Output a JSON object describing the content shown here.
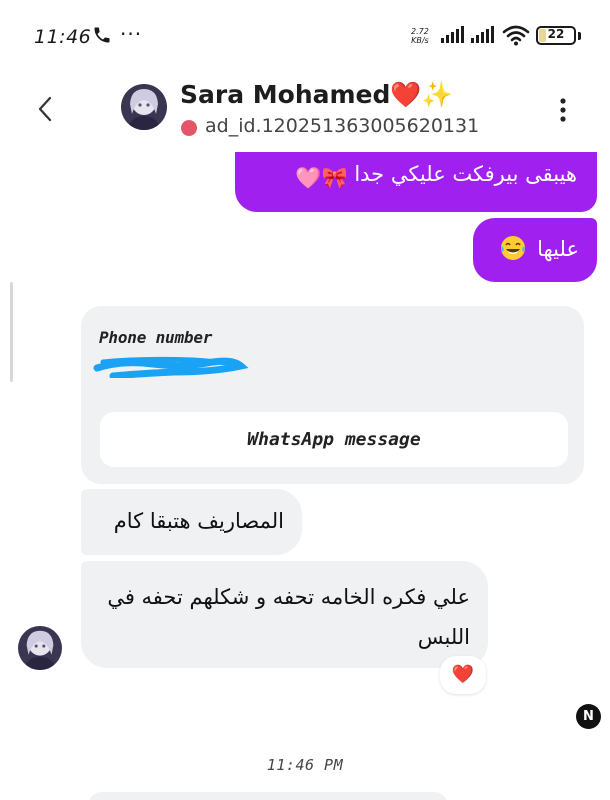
{
  "status_bar": {
    "time": "11:46",
    "more": "···",
    "net_speed_value": "2.72",
    "net_speed_unit": "KB/s",
    "battery": "22",
    "icons": [
      "phone-call-icon",
      "signal-icon",
      "signal-icon",
      "wifi-icon",
      "battery-icon"
    ]
  },
  "header": {
    "name": "Sara Mohamed",
    "name_emoji_heart": "❤️",
    "name_emoji_sparkle": "✨",
    "ad_id": "ad_id.120251363005620131",
    "icons": [
      "back-chevron-icon",
      "more-vert-icon"
    ]
  },
  "messages": {
    "outgoing_1": "هيبقى بيرفكت عليكي جدا",
    "outgoing_1_emojis": "🎀🩷",
    "outgoing_2": "عليها",
    "outgoing_2_emoji": "laughing-tears-emoji",
    "ad_card": {
      "phone_label": "Phone number",
      "button_label": "WhatsApp message"
    },
    "incoming_1": "المصاريف هتبقا كام",
    "incoming_2": "علي فكره الخامه تحفه و شكلهم تحفه في اللبس",
    "reaction": "❤️"
  },
  "badge": "N",
  "timestamp": "11:46 PM",
  "colors": {
    "outgoing_bubble": "#a020f0",
    "incoming_bubble": "#f0f1f3",
    "redact_blue": "#1aa3f5"
  }
}
